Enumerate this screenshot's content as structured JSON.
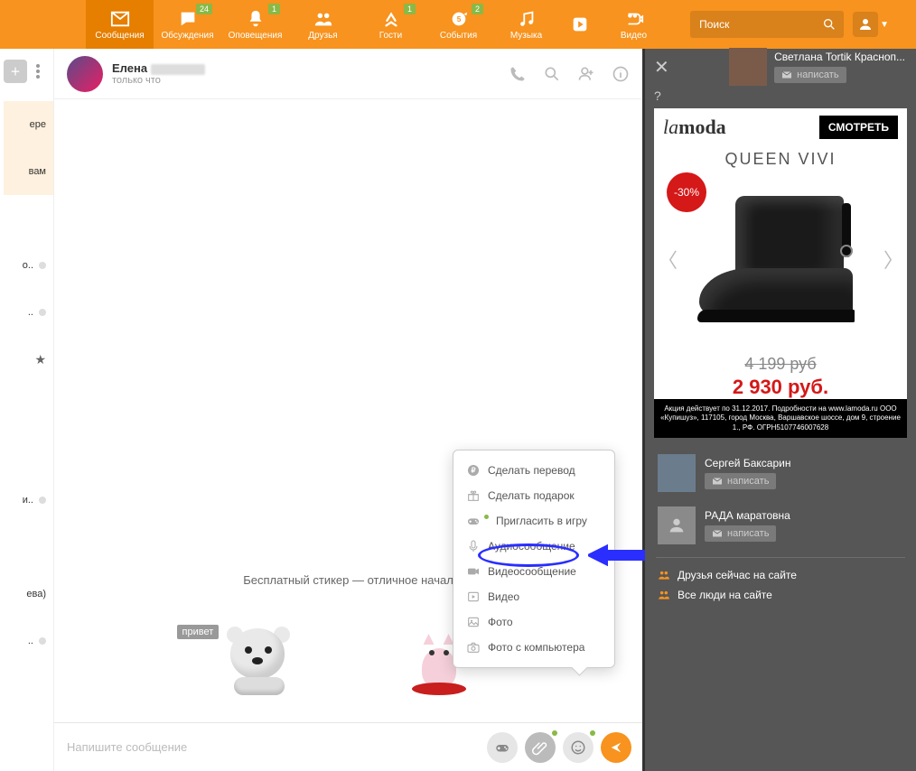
{
  "nav": {
    "items": [
      {
        "label": "Сообщения",
        "icon": "mail",
        "active": true
      },
      {
        "label": "Обсуждения",
        "icon": "chat",
        "badge": "24"
      },
      {
        "label": "Оповещения",
        "icon": "bell",
        "badge": "1"
      },
      {
        "label": "Друзья",
        "icon": "friends"
      },
      {
        "label": "Гости",
        "icon": "guests",
        "badge": "1"
      },
      {
        "label": "События",
        "icon": "events",
        "badge": "2"
      },
      {
        "label": "Музыка",
        "icon": "music"
      },
      {
        "label": "",
        "icon": "play"
      },
      {
        "label": "Видео",
        "icon": "video"
      }
    ],
    "search_placeholder": "Поиск"
  },
  "left": {
    "rows": [
      {
        "text": "ере",
        "highlight": true
      },
      {
        "text": "вам",
        "highlight": true
      },
      {
        "text": ""
      },
      {
        "text": "о..",
        "dot": true
      },
      {
        "text": "..",
        "dot": true
      },
      {
        "text": "",
        "star": true
      },
      {
        "text": ""
      },
      {
        "text": ""
      },
      {
        "text": "и..",
        "dot": true
      },
      {
        "text": ""
      },
      {
        "text": "ева)"
      },
      {
        "text": "..",
        "dot": true
      }
    ]
  },
  "chat": {
    "title_visible": "Елена",
    "subtitle": "только что",
    "header_icons": [
      "phone",
      "search",
      "add-user",
      "info"
    ],
    "sticker_hint": "Бесплатный стикер — отличное начал",
    "sticker1_tag": "привет",
    "composer_placeholder": "Напишите сообщение"
  },
  "attach_menu": [
    {
      "icon": "ruble",
      "label": "Сделать перевод"
    },
    {
      "icon": "gift",
      "label": "Сделать подарок"
    },
    {
      "icon": "gamepad",
      "label": "Пригласить в игру",
      "green_dot": true
    },
    {
      "icon": "mic",
      "label": "Аудиосообщение"
    },
    {
      "icon": "videocam",
      "label": "Видеосообщение"
    },
    {
      "icon": "play",
      "label": "Видео"
    },
    {
      "icon": "image",
      "label": "Фото"
    },
    {
      "icon": "camera",
      "label": "Фото с компьютера"
    }
  ],
  "right": {
    "top_contact": {
      "name": "Светлана Tortik Красноп...",
      "action": "написать"
    },
    "ad": {
      "brand_a": "la",
      "brand_b": "moda",
      "cta": "СМОТРЕТЬ",
      "title": "QUEEN VIVI",
      "discount": "-30%",
      "price_old": "4 199 руб",
      "price_new": "2 930 руб.",
      "legal": "Акция действует по 31.12.2017. Подробности на www.lamoda.ru ООО «Купишуз», 117105, город Москва, Варшавское шоссе, дом 9, строение 1., РФ. ОГРН5107746007628"
    },
    "contacts": [
      {
        "name": "Сергей Баксарин",
        "action": "написать",
        "thumb": "photo"
      },
      {
        "name": "РАДА маратовна",
        "action": "написать",
        "thumb": "empty"
      }
    ],
    "links": [
      {
        "icon": "friends",
        "label": "Друзья сейчас на сайте"
      },
      {
        "icon": "people",
        "label": "Все люди на сайте"
      }
    ]
  }
}
